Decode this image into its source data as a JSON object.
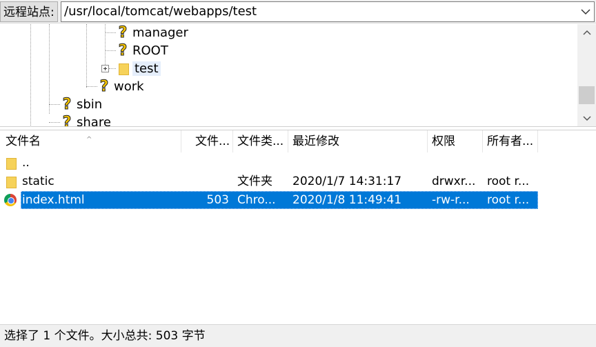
{
  "pathbar": {
    "label": "远程站点:",
    "path": "/usr/local/tomcat/webapps/test"
  },
  "tree": {
    "nodes": [
      {
        "label": "manager",
        "icon": "question-icon"
      },
      {
        "label": "ROOT",
        "icon": "question-icon"
      },
      {
        "label": "test",
        "icon": "folder-icon"
      },
      {
        "label": "work",
        "icon": "question-icon"
      },
      {
        "label": "sbin",
        "icon": "question-icon"
      },
      {
        "label": "share",
        "icon": "question-icon"
      }
    ]
  },
  "list": {
    "columns": [
      "文件名",
      "文件...",
      "文件类...",
      "最近修改",
      "权限",
      "所有者..."
    ],
    "rows": [
      {
        "name": "..",
        "size": "",
        "type": "",
        "modified": "",
        "perms": "",
        "owner": "",
        "icon": "folder-icon"
      },
      {
        "name": "static",
        "size": "",
        "type": "文件夹",
        "modified": "2020/1/7 14:31:17",
        "perms": "drwxr...",
        "owner": "root r...",
        "icon": "folder-icon"
      },
      {
        "name": "index.html",
        "size": "503",
        "type": "Chro...",
        "modified": "2020/1/8 11:49:41",
        "perms": "-rw-r...",
        "owner": "root r...",
        "icon": "chrome-icon",
        "selected": true
      }
    ]
  },
  "status": {
    "text": "选择了 1 个文件。大小总共: 503 字节"
  },
  "colors": {
    "selection": "#0078d7",
    "folder": "#f6d25a",
    "question": "#f7c600"
  }
}
